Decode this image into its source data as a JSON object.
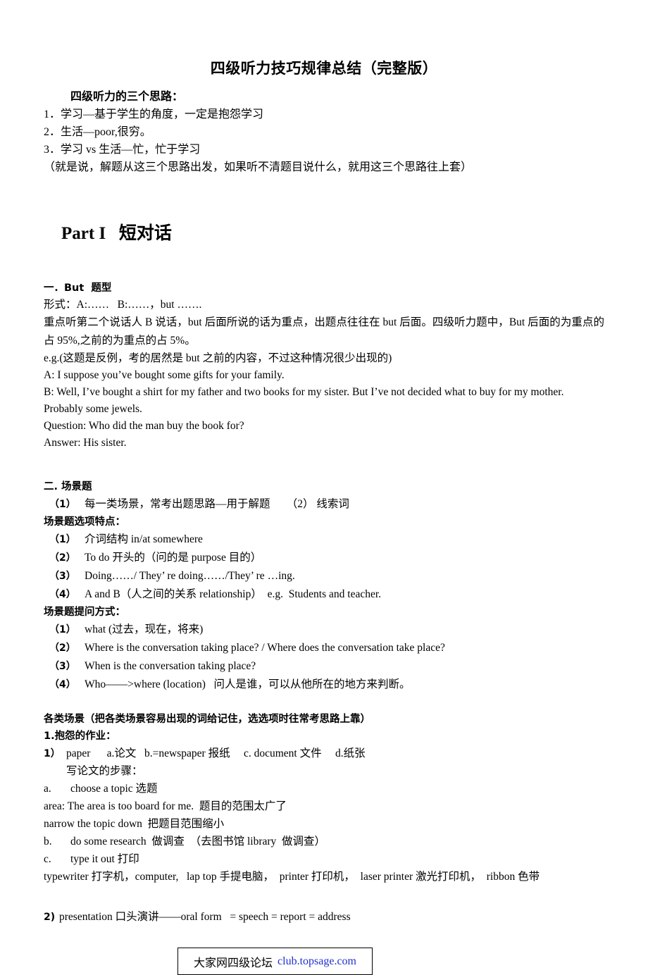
{
  "document": {
    "title": "四级听力技巧规律总结（完整版）"
  },
  "intro": {
    "heading": "四级听力的三个思路：",
    "items": [
      "1．学习—基于学生的角度，一定是抱怨学习",
      "2．生活—poor,很穷。",
      "3．学习 vs 生活—忙，忙于学习"
    ],
    "note": "（就是说，解题从这三个思路出发，如果听不清题目说什么，就用这三个思路往上套）"
  },
  "part": {
    "label": "Part I",
    "title": "短对话"
  },
  "section_but": {
    "heading": "一．But  题型",
    "form_line": "形式：A:……   B:……，but …….",
    "explain": "重点听第二个说话人 B 说话，but 后面所说的话为重点，出题点往往在 but 后面。四级听力题中，But 后面的为重点的占 95%,之前的为重点的占 5%。",
    "eg_note": "e.g.(这题是反例，考的居然是 but 之前的内容，不过这种情况很少出现的)",
    "dialogue": [
      "A: I suppose you’ve bought some gifts for your family.",
      "B: Well, I’ve bought a shirt for my father and two books for my sister. But I’ve not decided what to buy for my mother.",
      "Probably some jewels.",
      "Question: Who did the man buy the book for?",
      "Answer: His sister."
    ]
  },
  "section_scene": {
    "heading": "二. 场景题",
    "intro_row": {
      "num": "（1）",
      "text": "每一类场景，常考出题思路—用于解题      （2） 线索词"
    },
    "options_heading": "场景题选项特点：",
    "options": [
      {
        "num": "（1）",
        "text": "介词结构 in/at somewhere"
      },
      {
        "num": "（2）",
        "text": "To do 开头的（问的是 purpose 目的）"
      },
      {
        "num": "（3）",
        "text": "Doing……/ They’ re doing……/They’ re …ing."
      },
      {
        "num": "（4）",
        "text": "A and B（人之间的关系 relationship）  e.g.  Students and teacher."
      }
    ],
    "ask_heading": "场景题提问方式：",
    "asks": [
      {
        "num": "（1）",
        "text": "what (过去，现在，将来)"
      },
      {
        "num": "（2）",
        "text": "Where is the conversation taking place? / Where does the conversation take place?"
      },
      {
        "num": "（3）",
        "text": "When is the conversation taking place?"
      },
      {
        "num": "（4）",
        "text": "Who——>where (location)   问人是谁，可以从他所在的地方来判断。"
      }
    ]
  },
  "section_types": {
    "heading": "各类场景（把各类场景容易出现的词给记住，选选项时往常考思路上靠）",
    "sub_heading": "1.抱怨的作业：",
    "item1_num": "1）",
    "item1_text": "paper      a.论文   b.=newspaper 报纸     c. document 文件     d.纸张",
    "steps_heading": "写论文的步骤：",
    "steps": [
      {
        "mk": "a.",
        "text": "choose a topic 选题"
      },
      {
        "mk": "",
        "text": "area: The area is too board for me.  题目的范围太广了"
      },
      {
        "mk": "",
        "text": "narrow the topic down  把题目范围缩小"
      },
      {
        "mk": "b.",
        "text": "do some research  做调查  （去图书馆 library  做调查）"
      },
      {
        "mk": "c.",
        "text": "type it out 打印"
      },
      {
        "mk": "",
        "text": "typewriter 打字机，computer,   lap top 手提电脑，  printer 打印机，  laser printer 激光打印机，  ribbon 色带"
      }
    ],
    "item2_num": "2)",
    "item2_text": "presentation 口头演讲——oral form   = speech = report = address"
  },
  "footer": {
    "forum_name": "大家网四级论坛",
    "url": "club.topsage.com",
    "url_color": "#2030d0"
  }
}
